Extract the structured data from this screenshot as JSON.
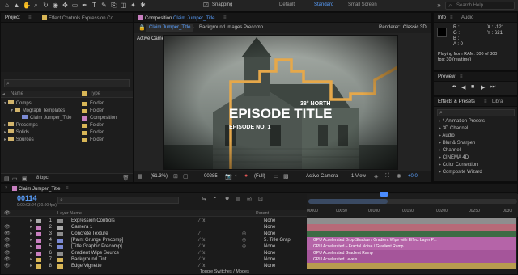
{
  "toolbar": {
    "snapping_label": "Snapping",
    "workspaces": [
      "Default",
      "Standard",
      "Small Screen"
    ],
    "active_workspace": "Standard",
    "search_placeholder": "Search Help"
  },
  "project_panel": {
    "tabs": [
      "Project",
      "Effect Controls Expression Co"
    ],
    "columns": {
      "name": "Name",
      "type": "Type"
    },
    "items": [
      {
        "name": "Comps",
        "type": "Folder",
        "kind": "folder",
        "indent": 0,
        "open": true
      },
      {
        "name": "Mograph Templates",
        "type": "Folder",
        "kind": "folder",
        "indent": 1,
        "open": true
      },
      {
        "name": "Claim Jumper_Title",
        "type": "Composition",
        "kind": "comp",
        "indent": 2,
        "open": false
      },
      {
        "name": "Precomps",
        "type": "Folder",
        "kind": "folder",
        "indent": 0,
        "open": false
      },
      {
        "name": "Solids",
        "type": "Folder",
        "kind": "folder",
        "indent": 0,
        "open": false
      },
      {
        "name": "Sources",
        "type": "Folder",
        "kind": "folder",
        "indent": 0,
        "open": false
      }
    ],
    "bpc_label": "8 bpc"
  },
  "composition_panel": {
    "tab_title": "Composition",
    "comp_name": "Claim Jumper_Title",
    "subtabs": [
      "Claim Jumper_Title",
      "Background Images Precomp"
    ],
    "renderer": "Renderer:",
    "renderer_value": "Classic 3D",
    "active_camera_label": "Active Camera",
    "canvas": {
      "title_small": "38° NORTH",
      "title_main": "EPISODE TITLE",
      "title_sub": "EPISODE NO. 1"
    },
    "footer": {
      "zoom": "(61.3%)",
      "timecode": "00285",
      "resolution": "(Full)",
      "camera": "Active Camera",
      "views": "1 View"
    }
  },
  "info_panel": {
    "tabs": [
      "Info",
      "Audio"
    ],
    "coords": [
      "X : -121",
      "Y : 621"
    ],
    "channels": [
      "R :",
      "G :",
      "B :",
      "A : 0"
    ],
    "message_line1": "Playing from RAM: 300 of 300",
    "message_line2": "fps: 30 (realtime)"
  },
  "preview_panel": {
    "title": "Preview"
  },
  "effects_panel": {
    "tabs": [
      "Effects & Presets",
      "Libra"
    ],
    "search_placeholder": "",
    "items": [
      "* Animation Presets",
      "3D Channel",
      "Audio",
      "Blur & Sharpen",
      "Channel",
      "CINEMA 4D",
      "Color Correction",
      "Composite Wizard"
    ]
  },
  "timeline": {
    "tab_name": "Claim Jumper_Title",
    "current_time": "00114",
    "time_sub": "0:00:03:24 (30.00 fps)",
    "columns": {
      "layer_name": "Layer Name",
      "parent": "Parent"
    },
    "ruler": [
      "00000",
      "00050",
      "00100",
      "00150",
      "00200",
      "00250",
      "0030"
    ],
    "footer": "Toggle Switches / Modes",
    "layers": [
      {
        "num": "1",
        "name": "Expression Controls",
        "parent": "None",
        "color": "#a8a8a8"
      },
      {
        "num": "2",
        "name": "Camera 1",
        "parent": "None",
        "color": "#c87fc0"
      },
      {
        "num": "3",
        "name": "Concrete Texture",
        "parent": "None",
        "color": "#c87fc0"
      },
      {
        "num": "4",
        "name": "[Paint Grunge Precomp]",
        "parent": "5. Title Grap",
        "color": "#c87fc0"
      },
      {
        "num": "5",
        "name": "[Title Graphic Precomp]",
        "parent": "None",
        "color": "#c87fc0"
      },
      {
        "num": "6",
        "name": "Gradient Wipe Source",
        "parent": "None",
        "color": "#c87fc0"
      },
      {
        "num": "7",
        "name": "Background Tint",
        "parent": "None",
        "color": "#d8b656"
      },
      {
        "num": "8",
        "name": "Edge Vignette",
        "parent": "None",
        "color": "#d8b656"
      }
    ],
    "effect_bars": [
      "GPU Accelerated Drop Shadow / Gradient Wipe with Effect Layer P...",
      "GPU Accelerated – Fractal Noise / Gradient Ramp",
      "GPU Accelerated Gradient Ramp",
      "GPU Accelerated Levels"
    ]
  }
}
